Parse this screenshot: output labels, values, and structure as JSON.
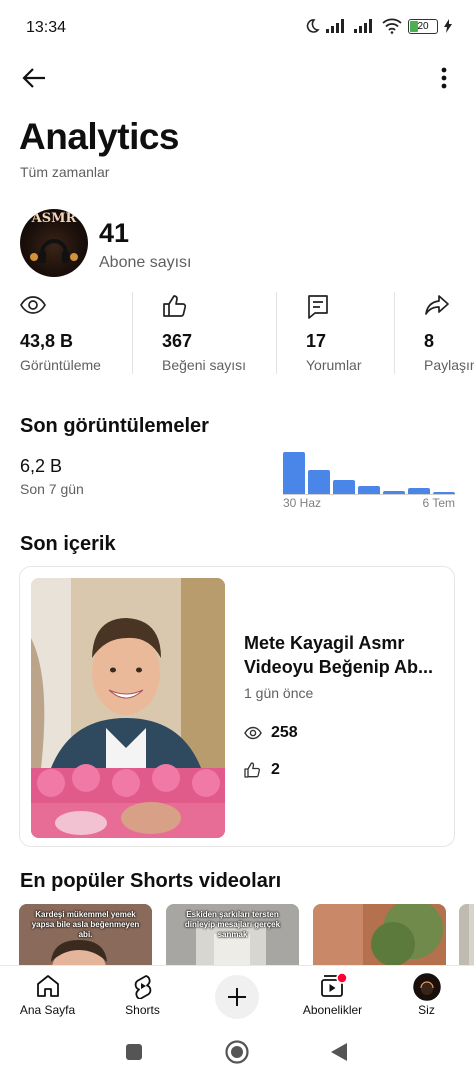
{
  "status_bar": {
    "time": "13:34",
    "battery": "20"
  },
  "header": {
    "title": "Analytics",
    "subtitle": "Tüm zamanlar"
  },
  "channel": {
    "avatar_text": "ASMR",
    "subscribers": "41",
    "subscribers_label": "Abone sayısı"
  },
  "stats": [
    {
      "icon": "eye-icon",
      "value": "43,8 B",
      "label": "Görüntüleme"
    },
    {
      "icon": "thumbs-up-icon",
      "value": "367",
      "label": "Beğeni sayısı"
    },
    {
      "icon": "comment-icon",
      "value": "17",
      "label": "Yorumlar"
    },
    {
      "icon": "share-icon",
      "value": "8",
      "label": "Paylaşım"
    }
  ],
  "recent_views": {
    "title": "Son görüntülemeler",
    "value": "6,2 B",
    "period": "Son 7 gün",
    "chart_start": "30 Haz",
    "chart_end": "6 Tem"
  },
  "chart_data": {
    "type": "bar",
    "categories": [
      "",
      "",
      "",
      "",
      "",
      "",
      ""
    ],
    "values": [
      100,
      58,
      34,
      18,
      8,
      15,
      5
    ],
    "title": "",
    "xlabel": "",
    "ylabel": "",
    "x_tick_labels": [
      "30 Haz",
      "6 Tem"
    ],
    "colors": [
      "#4a86e8"
    ],
    "grid": false
  },
  "recent_content": {
    "title": "Son içerik",
    "video_title_line1": "Mete Kayagil Asmr",
    "video_title_line2": "Videoyu Beğenip Ab...",
    "time": "1 gün önce",
    "views": "258",
    "likes": "2"
  },
  "shorts": {
    "title": "En popüler Shorts videoları",
    "items": [
      {
        "caption": "Kardeşi mükemmel yemek yapsa bile asla beğenmeyen abi."
      },
      {
        "caption": "Eskiden şarkıları tersten dinleyip mesajları gerçek sanmak"
      },
      {
        "caption": ""
      },
      {
        "caption": ""
      }
    ]
  },
  "bottom_nav": {
    "home": "Ana Sayfa",
    "shorts": "Shorts",
    "subscriptions": "Abonelikler",
    "you": "Siz"
  },
  "colors": {
    "accent": "#4a86e8",
    "notification": "#ff0033",
    "text_secondary": "#606060"
  }
}
